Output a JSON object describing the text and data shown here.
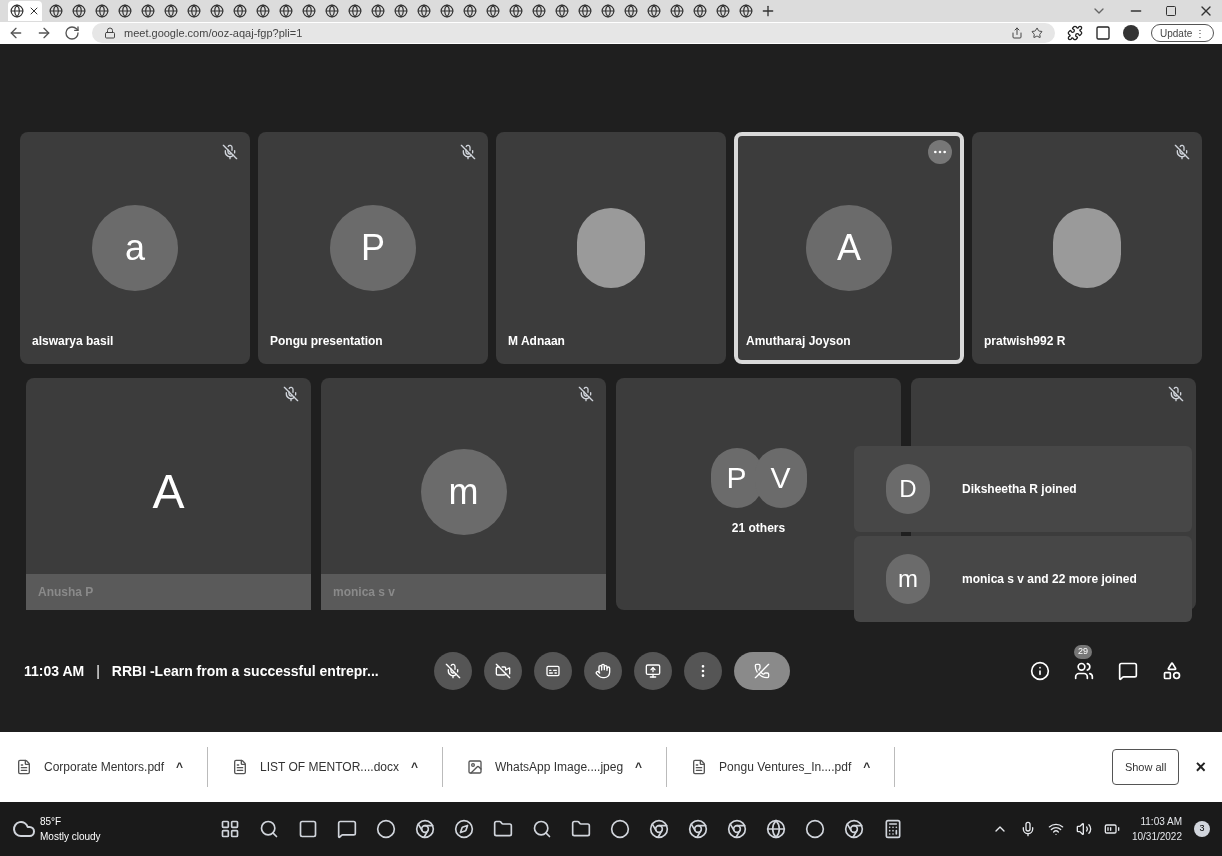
{
  "browser": {
    "tabs": [
      {
        "kind": "favicon",
        "selected": true,
        "closable": true
      },
      {
        "kind": "favicon",
        "selected": false,
        "closable": false
      },
      {
        "kind": "favicon",
        "selected": false,
        "closable": false
      },
      {
        "kind": "favicon",
        "selected": false,
        "closable": false
      },
      {
        "kind": "favicon",
        "selected": false,
        "closable": false
      },
      {
        "kind": "favicon",
        "selected": false,
        "closable": false
      },
      {
        "kind": "favicon",
        "selected": false,
        "closable": false
      },
      {
        "kind": "favicon",
        "selected": false,
        "closable": false
      },
      {
        "kind": "favicon",
        "selected": false,
        "closable": false
      },
      {
        "kind": "favicon",
        "selected": false,
        "closable": false
      },
      {
        "kind": "favicon",
        "selected": false,
        "closable": false
      },
      {
        "kind": "favicon",
        "selected": false,
        "closable": false
      },
      {
        "kind": "favicon",
        "selected": false,
        "closable": false
      },
      {
        "kind": "favicon",
        "selected": false,
        "closable": false
      },
      {
        "kind": "favicon",
        "selected": false,
        "closable": false
      },
      {
        "kind": "favicon",
        "selected": false,
        "closable": false
      },
      {
        "kind": "favicon",
        "selected": false,
        "closable": false
      },
      {
        "kind": "favicon",
        "selected": false,
        "closable": false
      },
      {
        "kind": "favicon",
        "selected": false,
        "closable": false
      },
      {
        "kind": "favicon",
        "selected": false,
        "closable": false
      },
      {
        "kind": "favicon",
        "selected": false,
        "closable": false
      },
      {
        "kind": "favicon",
        "selected": false,
        "closable": false
      },
      {
        "kind": "favicon",
        "selected": false,
        "closable": false
      },
      {
        "kind": "favicon",
        "selected": false,
        "closable": false
      },
      {
        "kind": "favicon",
        "selected": false,
        "closable": false
      },
      {
        "kind": "favicon",
        "selected": false,
        "closable": false
      },
      {
        "kind": "favicon",
        "selected": false,
        "closable": false
      },
      {
        "kind": "favicon",
        "selected": false,
        "closable": false
      },
      {
        "kind": "favicon",
        "selected": false,
        "closable": false
      },
      {
        "kind": "favicon",
        "selected": false,
        "closable": false
      },
      {
        "kind": "favicon",
        "selected": false,
        "closable": false
      },
      {
        "kind": "favicon",
        "selected": false,
        "closable": false
      }
    ],
    "url": "meet.google.com/ooz-aqaj-fgp?pli=1",
    "update_button": "Update",
    "update_menu": "⋮"
  },
  "tiles_row_1": [
    {
      "kind": "initial",
      "initial": "a",
      "name": "alswarya basil",
      "muted": true,
      "highlighted": false
    },
    {
      "kind": "initial",
      "initial": "P",
      "name": "Pongu presentation",
      "muted": true,
      "highlighted": false
    },
    {
      "kind": "photo",
      "name": "M Adnaan",
      "muted": false,
      "highlighted": false
    },
    {
      "kind": "initial",
      "initial": "A",
      "name": "Amutharaj Joyson",
      "muted": false,
      "highlighted": true
    },
    {
      "kind": "photo",
      "name": "pratwish992 R",
      "muted": true,
      "highlighted": false
    }
  ],
  "tiles_row_2": [
    {
      "kind": "initial",
      "initial": "A",
      "name": "Anusha P",
      "muted": true,
      "dimmed": true
    },
    {
      "kind": "initial",
      "initial": "m",
      "name": "monica s v",
      "muted": true,
      "dimmed": true
    },
    {
      "kind": "group",
      "initials": [
        "P",
        "V"
      ],
      "caption": "21 others",
      "muted": false,
      "dimmed": false
    },
    {
      "kind": "hidden",
      "muted": true,
      "dimmed": false
    }
  ],
  "toasts": [
    {
      "initial": "D",
      "message": "Diksheetha R joined"
    },
    {
      "initial": "m",
      "message": "monica s v and 22 more joined"
    }
  ],
  "meeting": {
    "time": "11:03 AM",
    "separator": "|",
    "title": "RRBI -Learn from a successful entrepr...",
    "participants_badge": "29"
  },
  "downloads": {
    "items": [
      {
        "kind": "pdf",
        "name": "Corporate Mentors.pdf",
        "caret": "^"
      },
      {
        "kind": "doc",
        "name": "LIST OF MENTOR....docx",
        "caret": "^"
      },
      {
        "kind": "image",
        "name": "WhatsApp Image....jpeg",
        "caret": "^"
      },
      {
        "kind": "pdf",
        "name": "Pongu Ventures_In....pdf",
        "caret": "^"
      }
    ],
    "show_all": "Show all",
    "close": "×"
  },
  "taskbar": {
    "temperature": "85°F",
    "weather": "Mostly cloudy",
    "time": "11:03 AM",
    "date": "10/31/2022",
    "notifications": "3"
  }
}
